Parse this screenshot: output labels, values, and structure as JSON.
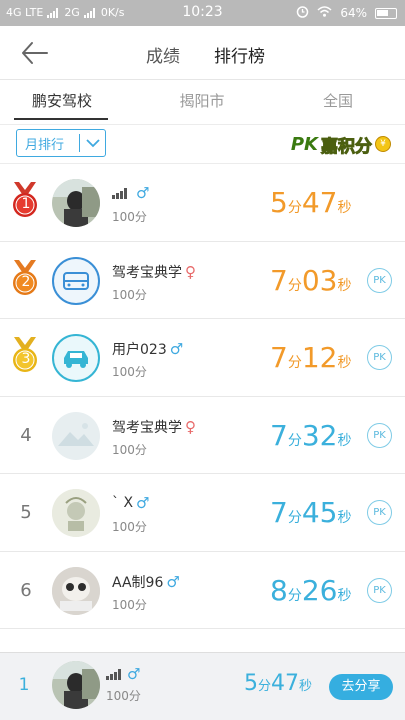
{
  "status_bar": {
    "network_left": "4G LTE",
    "network_mid": "2G",
    "speed": "0K/s",
    "time": "10:23",
    "battery": "64%"
  },
  "nav": {
    "tab_scores": "成绩",
    "tab_ranking": "排行榜"
  },
  "subtabs": [
    "鹏安驾校",
    "揭阳市",
    "全国"
  ],
  "filter": {
    "dropdown_label": "月排行",
    "pk_text": "PK",
    "pk_suffix": "嘉积分",
    "coin": "¥"
  },
  "ranking": [
    {
      "rank": "1",
      "name": "",
      "gender": "♂",
      "score": "100分",
      "min": "5",
      "min_unit": "分",
      "sec": "47",
      "sec_unit": "秒",
      "pk": ""
    },
    {
      "rank": "2",
      "name": "驾考宝典学",
      "gender": "♀",
      "score": "100分",
      "min": "7",
      "min_unit": "分",
      "sec": "03",
      "sec_unit": "秒",
      "pk": "PK"
    },
    {
      "rank": "3",
      "name": "用户023",
      "gender": "♂",
      "score": "100分",
      "min": "7",
      "min_unit": "分",
      "sec": "12",
      "sec_unit": "秒",
      "pk": "PK"
    },
    {
      "rank": "4",
      "name": "驾考宝典学",
      "gender": "♀",
      "score": "100分",
      "min": "7",
      "min_unit": "分",
      "sec": "32",
      "sec_unit": "秒",
      "pk": "PK"
    },
    {
      "rank": "5",
      "name": "` X",
      "gender": "♂",
      "score": "100分",
      "min": "7",
      "min_unit": "分",
      "sec": "45",
      "sec_unit": "秒",
      "pk": "PK"
    },
    {
      "rank": "6",
      "name": "AA制96",
      "gender": "♂",
      "score": "100分",
      "min": "8",
      "min_unit": "分",
      "sec": "26",
      "sec_unit": "秒",
      "pk": "PK"
    }
  ],
  "my_rank": {
    "rank": "1",
    "gender": "♂",
    "score": "100分",
    "min": "5",
    "min_unit": "分",
    "sec": "47",
    "sec_unit": "秒",
    "share_label": "去分享"
  },
  "colors": {
    "accent": "#3bb0dc",
    "gold_time": "#f29a2a",
    "male": "#3fa9e0",
    "female": "#e86a6a"
  }
}
